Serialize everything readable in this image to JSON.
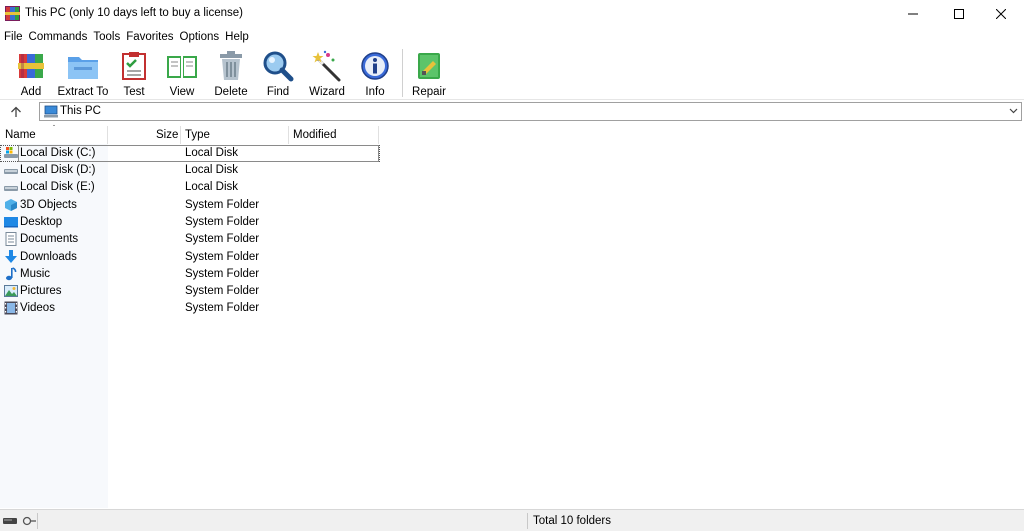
{
  "window": {
    "title": "This PC (only 10 days left to buy a license)"
  },
  "menu": [
    "File",
    "Commands",
    "Tools",
    "Favorites",
    "Options",
    "Help"
  ],
  "toolbar": {
    "buttons": [
      {
        "label": "Add",
        "icon": "add-archive-icon"
      },
      {
        "label": "Extract To",
        "icon": "extract-folder-icon"
      },
      {
        "label": "Test",
        "icon": "test-checklist-icon"
      },
      {
        "label": "View",
        "icon": "view-book-icon"
      },
      {
        "label": "Delete",
        "icon": "trash-icon"
      },
      {
        "label": "Find",
        "icon": "magnifier-icon"
      },
      {
        "label": "Wizard",
        "icon": "magic-wand-icon"
      },
      {
        "label": "Info",
        "icon": "info-icon"
      },
      {
        "label": "Repair",
        "icon": "repair-icon"
      }
    ]
  },
  "address": {
    "path": "This PC"
  },
  "columns": {
    "name": "Name",
    "size": "Size",
    "type": "Type",
    "modified": "Modified"
  },
  "files": [
    {
      "name": "Local Disk (C:)",
      "type": "Local Disk",
      "icon": "system-drive-icon"
    },
    {
      "name": "Local Disk (D:)",
      "type": "Local Disk",
      "icon": "drive-icon"
    },
    {
      "name": "Local Disk (E:)",
      "type": "Local Disk",
      "icon": "drive-icon"
    },
    {
      "name": "3D Objects",
      "type": "System Folder",
      "icon": "cube-icon"
    },
    {
      "name": "Desktop",
      "type": "System Folder",
      "icon": "desktop-icon"
    },
    {
      "name": "Documents",
      "type": "System Folder",
      "icon": "document-icon"
    },
    {
      "name": "Downloads",
      "type": "System Folder",
      "icon": "download-icon"
    },
    {
      "name": "Music",
      "type": "System Folder",
      "icon": "music-note-icon"
    },
    {
      "name": "Pictures",
      "type": "System Folder",
      "icon": "picture-icon"
    },
    {
      "name": "Videos",
      "type": "System Folder",
      "icon": "film-icon"
    }
  ],
  "status": {
    "text": "Total 10 folders"
  }
}
